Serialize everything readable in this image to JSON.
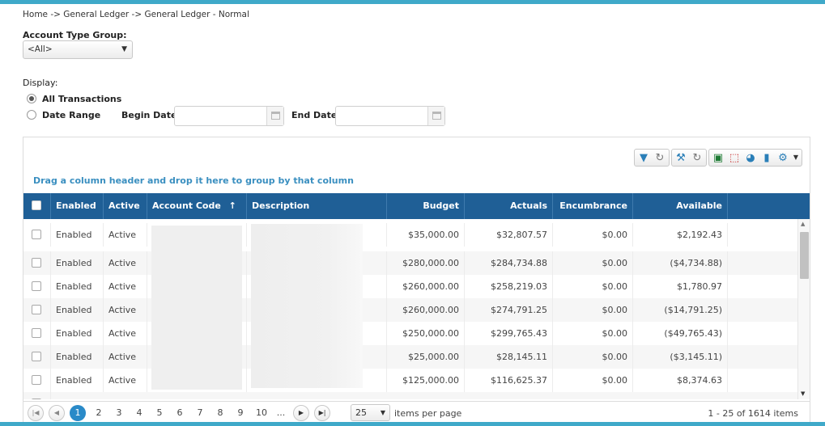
{
  "breadcrumb": "Home -> General Ledger -> General Ledger - Normal",
  "filters": {
    "account_type_group_label": "Account Type Group:",
    "account_type_group_value": "<All>",
    "display_label": "Display:",
    "all_transactions_label": "All Transactions",
    "date_range_label": "Date Range",
    "begin_date_label": "Begin Date",
    "end_date_label": "End Date",
    "begin_date_value": "",
    "end_date_value": "",
    "selected_display": "All Transactions"
  },
  "toolbar": {
    "icons": [
      "filter-icon",
      "refresh-icon",
      "wrench-icon",
      "reset-icon",
      "excel-icon",
      "pdf-icon",
      "pie-chart-icon",
      "document-icon",
      "gear-icon"
    ]
  },
  "grid": {
    "group_hint": "Drag a column header and drop it here to group by that column",
    "columns": {
      "enabled": "Enabled",
      "active": "Active",
      "account_code": "Account Code",
      "sort_indicator": "↑",
      "description": "Description",
      "budget": "Budget",
      "actuals": "Actuals",
      "encumbrance": "Encumbrance",
      "available": "Available"
    },
    "rows": [
      {
        "enabled": "Enabled",
        "active": "Active",
        "budget": "$35,000.00",
        "actuals": "$32,807.57",
        "encumbrance": "$0.00",
        "available": "$2,192.43"
      },
      {
        "enabled": "Enabled",
        "active": "Active",
        "budget": "$280,000.00",
        "actuals": "$284,734.88",
        "encumbrance": "$0.00",
        "available": "($4,734.88)"
      },
      {
        "enabled": "Enabled",
        "active": "Active",
        "budget": "$260,000.00",
        "actuals": "$258,219.03",
        "encumbrance": "$0.00",
        "available": "$1,780.97"
      },
      {
        "enabled": "Enabled",
        "active": "Active",
        "budget": "$260,000.00",
        "actuals": "$274,791.25",
        "encumbrance": "$0.00",
        "available": "($14,791.25)"
      },
      {
        "enabled": "Enabled",
        "active": "Active",
        "budget": "$250,000.00",
        "actuals": "$299,765.43",
        "encumbrance": "$0.00",
        "available": "($49,765.43)"
      },
      {
        "enabled": "Enabled",
        "active": "Active",
        "budget": "$25,000.00",
        "actuals": "$28,145.11",
        "encumbrance": "$0.00",
        "available": "($3,145.11)"
      },
      {
        "enabled": "Enabled",
        "active": "Active",
        "budget": "$125,000.00",
        "actuals": "$116,625.37",
        "encumbrance": "$0.00",
        "available": "$8,374.63"
      }
    ]
  },
  "pager": {
    "pages": [
      "1",
      "2",
      "3",
      "4",
      "5",
      "6",
      "7",
      "8",
      "9",
      "10",
      "..."
    ],
    "current_page": "1",
    "page_size": "25",
    "items_per_page_label": "items per page",
    "info": "1 - 25 of 1614 items"
  },
  "colors": {
    "accent_bar": "#3fa9c9",
    "header_bg": "#1f5f96",
    "link_blue": "#3a8fc0",
    "active_page": "#2a8ac8"
  }
}
